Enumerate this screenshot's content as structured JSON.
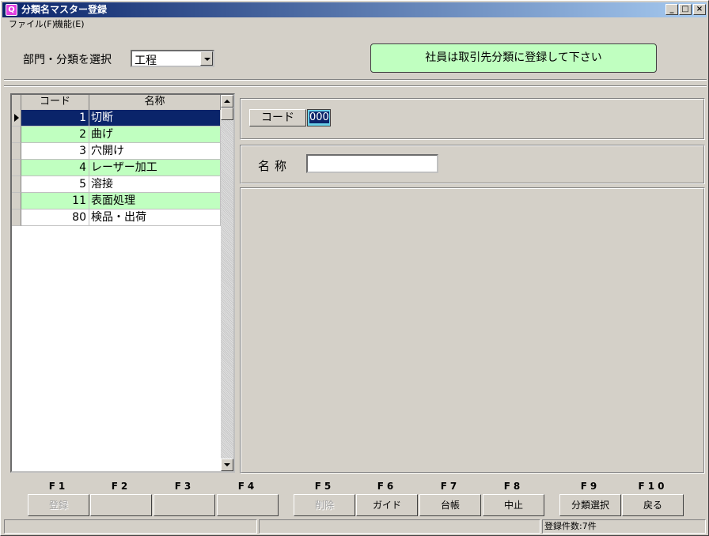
{
  "window": {
    "title": "分類名マスター登録",
    "app_icon": "Q",
    "controls": {
      "minimize": "_",
      "maximize": "□",
      "close": "×"
    }
  },
  "menu": [
    {
      "label": "ファイル(F)"
    },
    {
      "label": "機能(E)"
    }
  ],
  "selector": {
    "label": "部門・分類を選択",
    "value": "工程"
  },
  "notice": "社員は取引先分類に登録して下さい",
  "grid": {
    "headers": {
      "code": "コード",
      "name": "名称"
    },
    "rows": [
      {
        "code": "1",
        "name": "切断",
        "selected": true
      },
      {
        "code": "2",
        "name": "曲げ"
      },
      {
        "code": "3",
        "name": "穴開け"
      },
      {
        "code": "4",
        "name": "レーザー加工"
      },
      {
        "code": "5",
        "name": "溶接"
      },
      {
        "code": "11",
        "name": "表面処理"
      },
      {
        "code": "80",
        "name": "検品・出荷"
      }
    ]
  },
  "form": {
    "code_label": "コード",
    "code_value": "000",
    "name_label": "名称",
    "name_value": ""
  },
  "fkeys": [
    {
      "key": "F1",
      "label": "登録",
      "enabled": false
    },
    {
      "key": "F2",
      "label": "",
      "enabled": true
    },
    {
      "key": "F3",
      "label": "",
      "enabled": true
    },
    {
      "key": "F4",
      "label": "",
      "enabled": true
    },
    {
      "key": "F5",
      "label": "削除",
      "enabled": false
    },
    {
      "key": "F6",
      "label": "ガイド",
      "enabled": true
    },
    {
      "key": "F7",
      "label": "台帳",
      "enabled": true
    },
    {
      "key": "F8",
      "label": "中止",
      "enabled": true
    },
    {
      "key": "F9",
      "label": "分類選択",
      "enabled": true
    },
    {
      "key": "F10",
      "label": "戻る",
      "enabled": true
    }
  ],
  "status": {
    "pane1": "",
    "pane2": "",
    "pane3": "登録件数:7件"
  },
  "colors": {
    "title_start": "#0a246a",
    "title_end": "#a6caf0",
    "row_green": "#c0ffc0",
    "selected": "#0a246a",
    "face": "#d4d0c8"
  }
}
